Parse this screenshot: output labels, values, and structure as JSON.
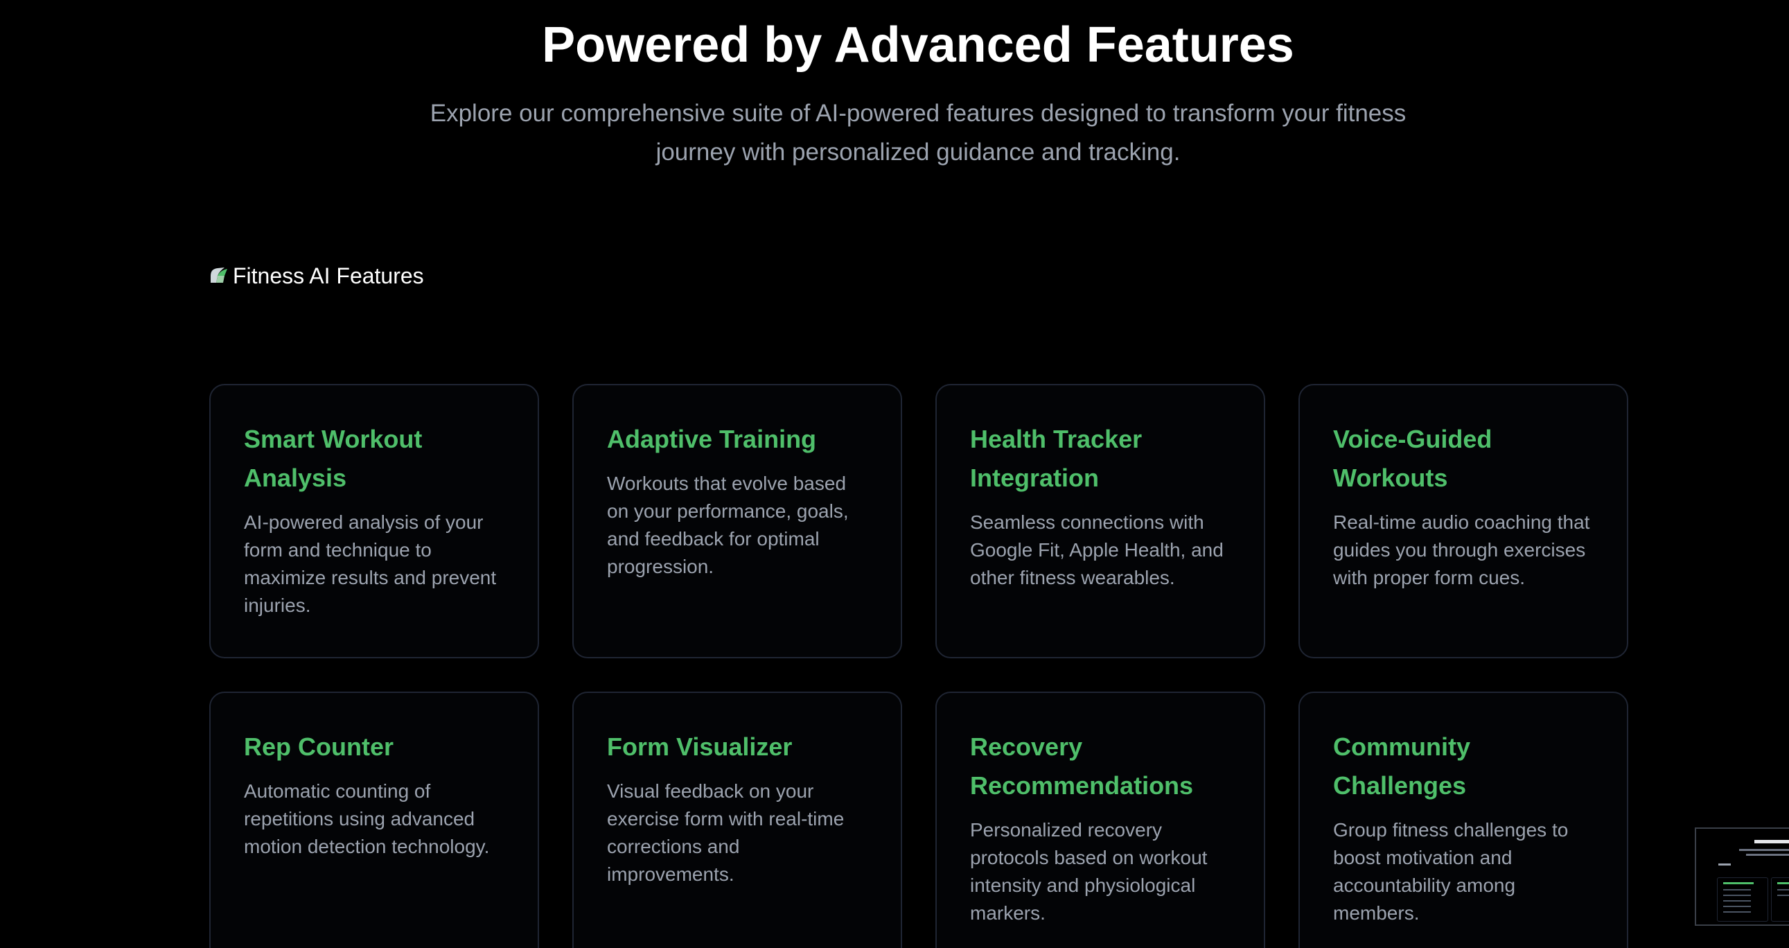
{
  "header": {
    "title": "Powered by Advanced Features",
    "subtitle": "Explore our comprehensive suite of AI-powered features designed to transform your fitness journey with personalized guidance and tracking."
  },
  "hero_image": {
    "alt": "Fitness AI Features",
    "icon": "broken-image-icon"
  },
  "features": [
    {
      "title": "Smart Workout Analysis",
      "description": "AI-powered analysis of your form and technique to maximize results and prevent injuries."
    },
    {
      "title": "Adaptive Training",
      "description": "Workouts that evolve based on your performance, goals, and feedback for optimal progression."
    },
    {
      "title": "Health Tracker Integration",
      "description": "Seamless connections with Google Fit, Apple Health, and other fitness wearables."
    },
    {
      "title": "Voice-Guided Workouts",
      "description": "Real-time audio coaching that guides you through exercises with proper form cues."
    },
    {
      "title": "Rep Counter",
      "description": "Automatic counting of repetitions using advanced motion detection technology."
    },
    {
      "title": "Form Visualizer",
      "description": "Visual feedback on your exercise form with real-time corrections and improvements."
    },
    {
      "title": "Recovery Recommendations",
      "description": "Personalized recovery protocols based on workout intensity and physiological markers."
    },
    {
      "title": "Community Challenges",
      "description": "Group fitness challenges to boost motivation and accountability among members."
    }
  ],
  "colors": {
    "background": "#000000",
    "accent": "#4fbf6a",
    "muted_text": "#9ca3af",
    "card_border": "#1f2533"
  }
}
